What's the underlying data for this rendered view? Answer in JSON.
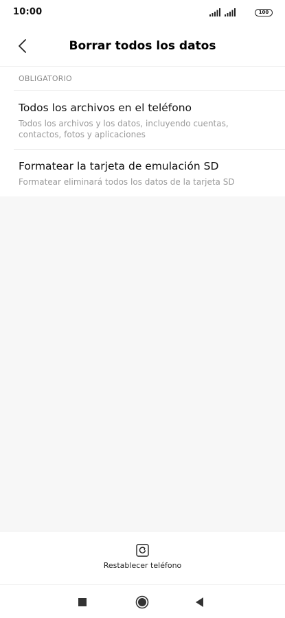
{
  "status_bar": {
    "time": "10:00",
    "battery": "100"
  },
  "header": {
    "title": "Borrar todos los datos",
    "back_icon": "chevron-left-icon"
  },
  "section": {
    "label": "OBLIGATORIO"
  },
  "items": [
    {
      "title": "Todos los archivos en el teléfono",
      "subtitle": "Todos los archivos y los datos, incluyendo cuentas, contactos, fotos y aplicaciones"
    },
    {
      "title": "Formatear la tarjeta de emulación SD",
      "subtitle": "Formatear eliminará todos los datos de la tarjeta SD"
    }
  ],
  "bottom_action": {
    "label": "Restablecer teléfono",
    "icon": "reset-icon"
  },
  "nav_bar": {
    "recent_icon": "square-icon",
    "home_icon": "circle-icon",
    "back_icon": "triangle-back-icon"
  },
  "colors": {
    "background": "#ffffff",
    "empty_area": "#f7f7f7",
    "secondary_text": "#9a9a9a",
    "divider": "#ececec"
  }
}
